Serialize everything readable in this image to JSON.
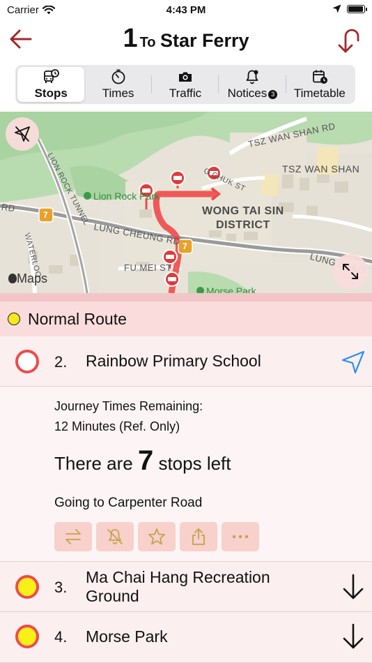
{
  "status_bar": {
    "carrier": "Carrier",
    "time": "4:43 PM",
    "battery_level": 0.95
  },
  "nav": {
    "route_number": "1",
    "to_label": "To",
    "destination": "Star Ferry",
    "accent_color": "#a0282a"
  },
  "tabs": [
    {
      "label": "Stops",
      "icon": "bus-clock-icon",
      "active": true
    },
    {
      "label": "Times",
      "icon": "stopwatch-icon",
      "active": false
    },
    {
      "label": "Traffic",
      "icon": "camera-icon",
      "active": false
    },
    {
      "label": "Notices",
      "icon": "bell-icon",
      "badge": "3",
      "active": false
    },
    {
      "label": "Timetable",
      "icon": "calendar-clock-icon",
      "active": false
    }
  ],
  "map": {
    "labels": {
      "tsz_wan_shan_rd": "TSZ WAN SHAN RD",
      "tsz_wan_shan": "TSZ WAN SHAN",
      "chuk_st": "G CHUK ST",
      "lion_rock_tunnel": "LION ROCK TUNNEL",
      "rd_left": "RD",
      "waterloo": "WATERLOO",
      "lung_cheung_rd": "LUNG CHEUNG RD",
      "lung_cheung_right": "LUNG CHEU",
      "fu_mei_st": "FU MEI ST",
      "district_1": "WONG TAI SIN",
      "district_2": "DISTRICT",
      "lion_rock_park": "Lion Rock Park",
      "morse_park": "Morse Park",
      "highway_number": "7",
      "legal": "Maps"
    }
  },
  "route": {
    "header": "Normal Route",
    "route_color": "#f04a4a",
    "stops": [
      {
        "index": "2.",
        "name": "Rainbow Primary School"
      },
      {
        "index": "3.",
        "name": "Ma Chai Hang Recreation Ground"
      },
      {
        "index": "4.",
        "name": "Morse Park"
      }
    ],
    "detail": {
      "journey_times_label": "Journey Times Remaining:",
      "journey_times_value": "12 Minutes (Ref. Only)",
      "stops_left_prefix": "There are",
      "stops_left_count": "7",
      "stops_left_suffix": "stops left",
      "going_to": "Going to Carpenter Road"
    }
  }
}
